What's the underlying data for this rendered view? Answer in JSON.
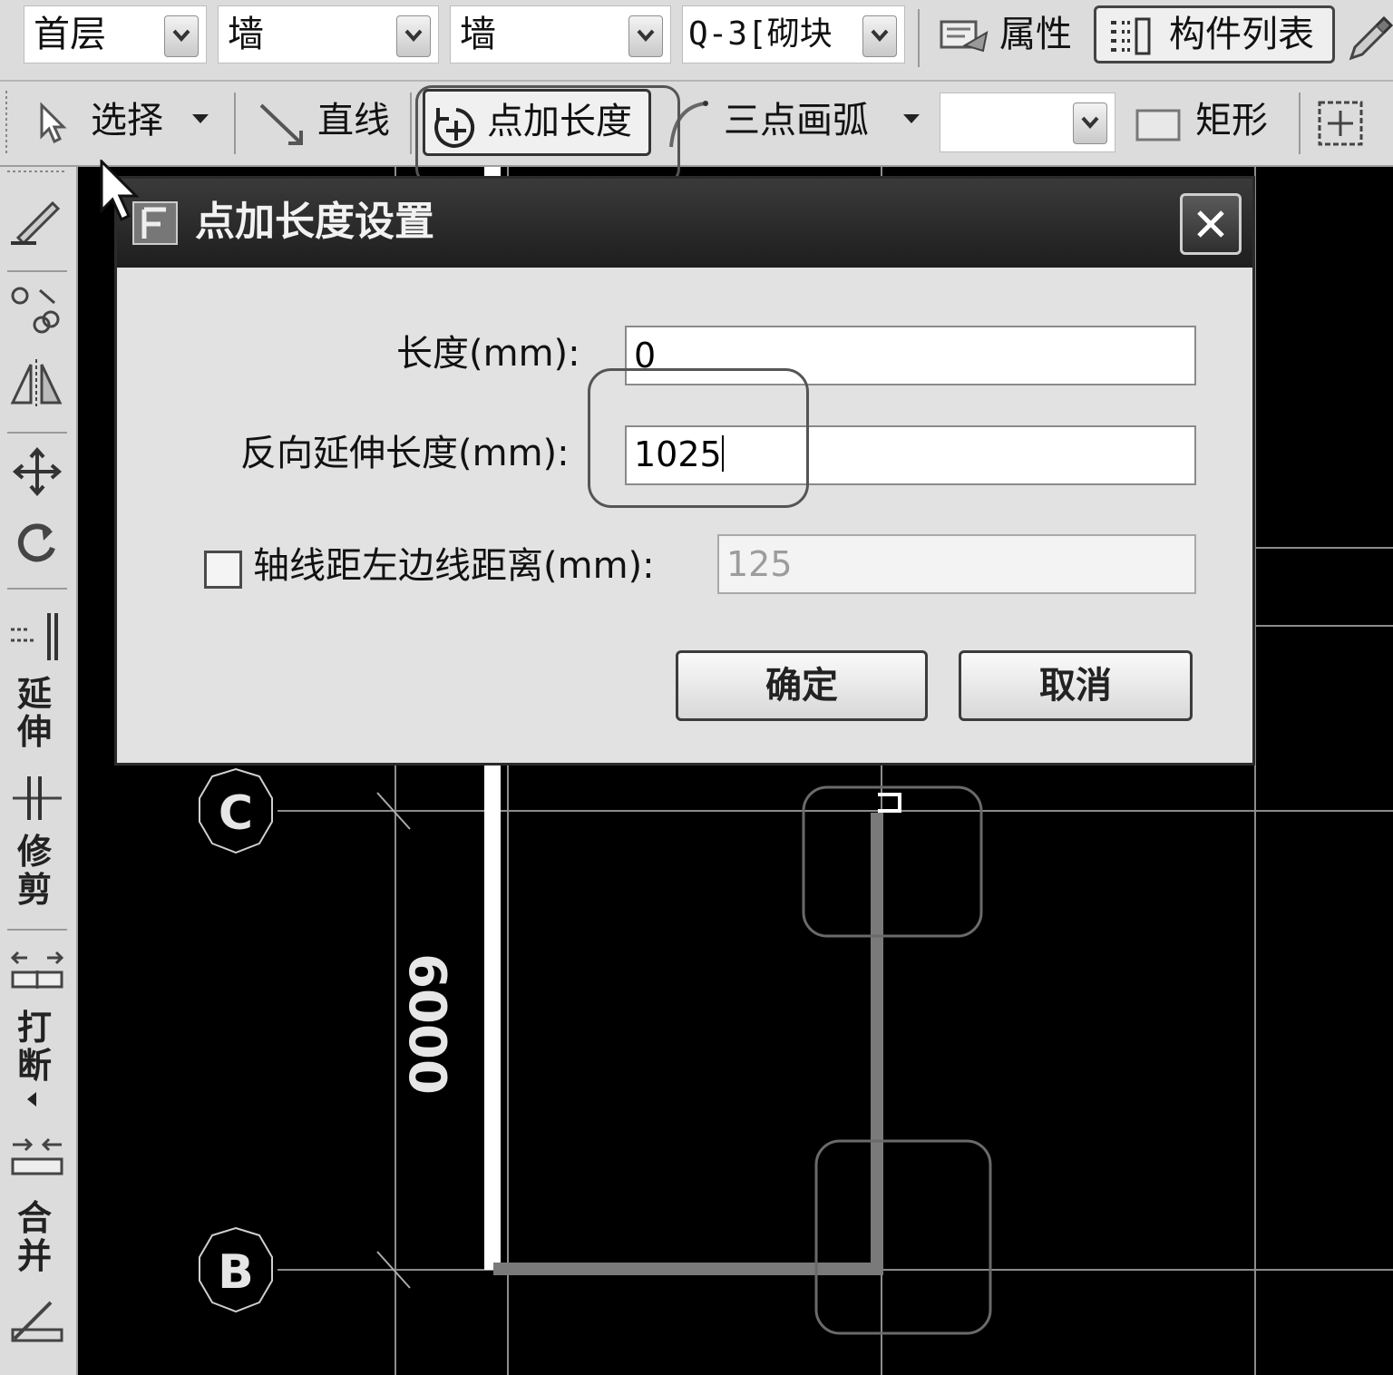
{
  "toolbar1": {
    "floor": "首层",
    "type": "墙",
    "subtype": "墙",
    "component": "Q-3[砌块",
    "properties_label": "属性",
    "component_list_label": "构件列表"
  },
  "toolbar2": {
    "select_label": "选择",
    "line_label": "直线",
    "point_length_label": "点加长度",
    "arc_label": "三点画弧",
    "arc_mode_value": "",
    "rect_label": "矩形"
  },
  "left_toolbar": {
    "extend_label": "延伸",
    "trim_label": "修剪",
    "break_label": "打断",
    "merge_label": "合并"
  },
  "canvas": {
    "axis_c": "C",
    "axis_b": "B",
    "dimension": "6000"
  },
  "dialog": {
    "title": "点加长度设置",
    "length_label": "长度(mm):",
    "length_value": "0",
    "reverse_label": "反向延伸长度(mm):",
    "reverse_value": "1025",
    "axis_offset_label": "轴线距左边线距离(mm):",
    "axis_offset_value": "125",
    "axis_offset_checked": false,
    "ok_label": "确定",
    "cancel_label": "取消"
  }
}
